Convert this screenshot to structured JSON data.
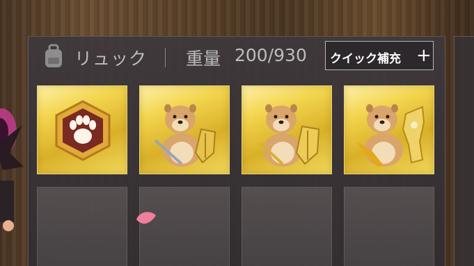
{
  "inventory": {
    "title": "リュック",
    "weight_label": "重量",
    "weight_value": "200/930",
    "quick_refill_label": "クイック補充",
    "plus_symbol": "+"
  },
  "slots": [
    {
      "content": "paw-badge-icon",
      "state": "filled"
    },
    {
      "content": "shiba-sword-shield-icon",
      "state": "filled"
    },
    {
      "content": "shiba-golden-sword-shield-icon",
      "state": "filled"
    },
    {
      "content": "shiba-ornate-weapon-shield-icon",
      "state": "filled"
    },
    {
      "content": "",
      "state": "empty"
    },
    {
      "content": "",
      "state": "empty"
    },
    {
      "content": "",
      "state": "empty"
    },
    {
      "content": "",
      "state": "empty"
    }
  ],
  "colors": {
    "gold_slot": "#f3d54e",
    "panel": "#3e383c",
    "text_muted": "#bdbdbd",
    "badge_red": "#7a2a20"
  }
}
